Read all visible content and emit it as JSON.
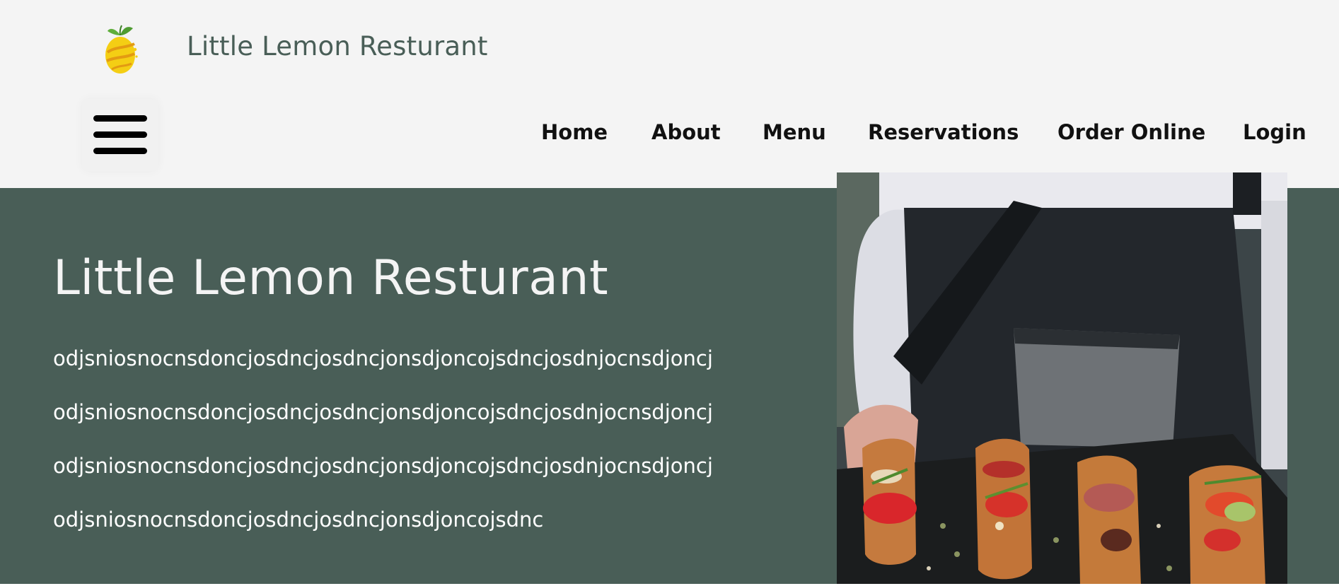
{
  "header": {
    "brand_title": "Little Lemon Resturant",
    "logo_icon": "lemon-logo-icon",
    "menu_icon": "hamburger-menu-icon"
  },
  "nav": {
    "items": [
      {
        "label": "Home"
      },
      {
        "label": "About"
      },
      {
        "label": "Menu"
      },
      {
        "label": "Reservations"
      },
      {
        "label": "Order Online"
      },
      {
        "label": "Login"
      }
    ]
  },
  "hero": {
    "title": "Little Lemon Resturant",
    "lines": [
      "odjsniosnocnsdoncjosdncjosdncjonsdjoncojsdncjosdnjocnsdjoncj",
      "odjsniosnocnsdoncjosdncjosdncjonsdjoncojsdncjosdnjocnsdjoncj",
      "odjsniosnocnsdoncjosdncjosdncjonsdjoncojsdncjosdnjocnsdjoncj",
      "odjsniosnocnsdoncjosdncjosdncjonsdjoncojsdnc"
    ],
    "image": "chef-holding-tray-of-bruschetta"
  },
  "colors": {
    "primary_green": "#495e57",
    "header_bg": "#f4f4f4",
    "lemon_yellow": "#f4ce14"
  }
}
